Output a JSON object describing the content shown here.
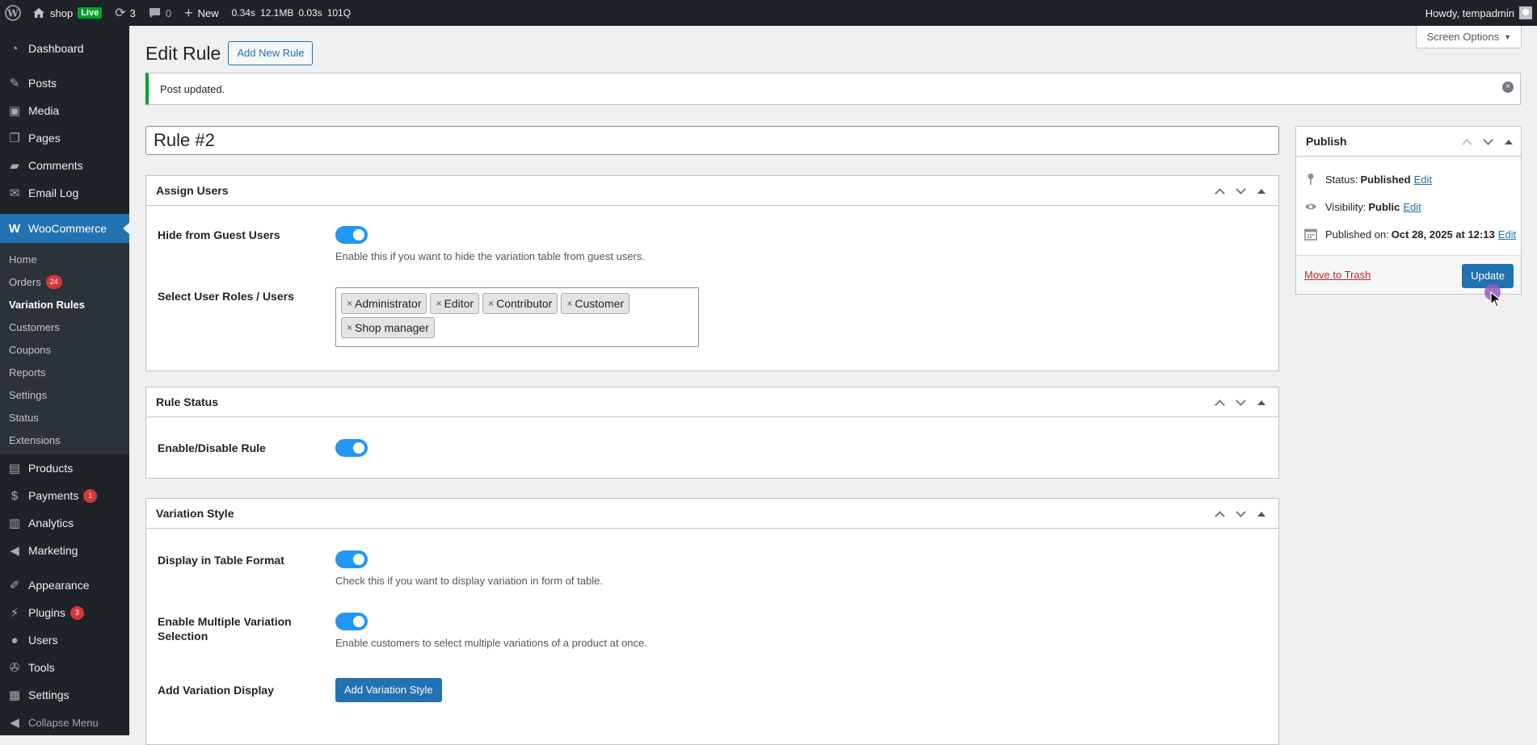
{
  "adminbar": {
    "site_name": "shop",
    "live_badge": "Live",
    "updates_count": "3",
    "comments_count": "0",
    "new_label": "New",
    "perf_time": "0.34s",
    "perf_memory": "12.1MB",
    "perf_query_time": "0.03s",
    "perf_queries": "101Q",
    "howdy": "Howdy, tempadmin"
  },
  "sidebar": {
    "dashboard": "Dashboard",
    "posts": "Posts",
    "media": "Media",
    "pages": "Pages",
    "comments": "Comments",
    "email_log": "Email Log",
    "woocommerce": "WooCommerce",
    "woo_submenu": {
      "home": "Home",
      "orders": "Orders",
      "orders_count": "24",
      "variation_rules": "Variation Rules",
      "customers": "Customers",
      "coupons": "Coupons",
      "reports": "Reports",
      "settings": "Settings",
      "status": "Status",
      "extensions": "Extensions"
    },
    "products": "Products",
    "payments": "Payments",
    "payments_count": "1",
    "analytics": "Analytics",
    "marketing": "Marketing",
    "appearance": "Appearance",
    "plugins": "Plugins",
    "plugins_count": "3",
    "users": "Users",
    "tools": "Tools",
    "settings": "Settings",
    "collapse": "Collapse Menu"
  },
  "header": {
    "screen_options": "Screen Options",
    "title": "Edit Rule",
    "add_new": "Add New Rule"
  },
  "notice": {
    "text": "Post updated."
  },
  "post_title": "Rule #2",
  "assign_users": {
    "title": "Assign Users",
    "hide_guest_label": "Hide from Guest Users",
    "hide_guest_help": "Enable this if you want to hide the variation table from guest users.",
    "hide_guest_enabled": true,
    "roles_label": "Select User Roles / Users",
    "roles": [
      "Administrator",
      "Editor",
      "Contributor",
      "Customer",
      "Shop manager"
    ]
  },
  "rule_status": {
    "title": "Rule Status",
    "enable_label": "Enable/Disable Rule",
    "enabled": true
  },
  "variation_style": {
    "title": "Variation Style",
    "table_format_label": "Display in Table Format",
    "table_format_help": "Check this if you want to display variation in form of table.",
    "table_format_enabled": true,
    "multi_label": "Enable Multiple Variation Selection",
    "multi_help": "Enable customers to select multiple variations of a product at once.",
    "multi_enabled": true,
    "add_display_label": "Add Variation Display",
    "add_style_button": "Add Variation Style"
  },
  "publish": {
    "title": "Publish",
    "status_label": "Status:",
    "status_value": "Published",
    "visibility_label": "Visibility:",
    "visibility_value": "Public",
    "published_label": "Published on:",
    "published_value": "Oct 28, 2025 at 12:13",
    "edit_link": "Edit",
    "trash_link": "Move to Trash",
    "update_button": "Update"
  },
  "colors": {
    "accent": "#2271b1",
    "toggle_on": "#2196f3",
    "admin_dark": "#1d2327",
    "notice_success": "#00a32a",
    "badge_red": "#d63638"
  }
}
